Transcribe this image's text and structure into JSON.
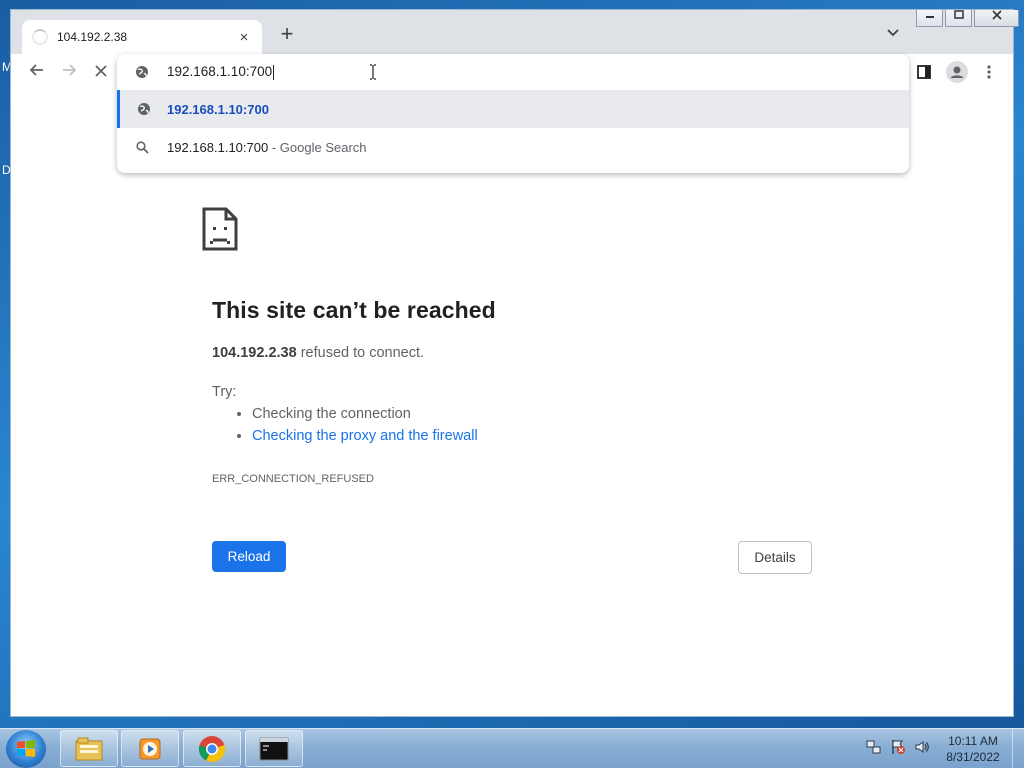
{
  "desktop": {
    "edge_letters": [
      "M",
      "D"
    ]
  },
  "browser": {
    "tab_title": "104.192.2.38",
    "tab_close": "×",
    "new_tab": "+",
    "tab_search": "⌄",
    "window_controls": {
      "minimize": "—",
      "maximize": "□",
      "close": "✕"
    },
    "nav": {
      "back": "←",
      "forward": "→",
      "stop": "✕"
    },
    "omnibox": {
      "typed_text": "192.168.1.10:700",
      "suggestions": [
        {
          "type": "url",
          "icon": "globe-icon",
          "text": "192.168.1.10:700",
          "selected": true
        },
        {
          "type": "search",
          "icon": "search-icon",
          "text": "192.168.1.10:700",
          "suffix": "- Google Search"
        }
      ]
    }
  },
  "error_page": {
    "title": "This site can’t be reached",
    "host": "104.192.2.38",
    "desc_rest": "refused to connect.",
    "try_label": "Try:",
    "suggestions": [
      {
        "text": "Checking the connection",
        "link": false
      },
      {
        "text": "Checking the proxy and the firewall",
        "link": true
      }
    ],
    "error_code": "ERR_CONNECTION_REFUSED",
    "reload_label": "Reload",
    "details_label": "Details"
  },
  "taskbar": {
    "apps": [
      "explorer-icon",
      "media-player-icon",
      "chrome-icon",
      "cmd-icon"
    ],
    "clock_time": "10:11 AM",
    "clock_date": "8/31/2022"
  },
  "colors": {
    "accent": "#1a73e8",
    "link": "#1a73e8",
    "text": "#202124"
  }
}
